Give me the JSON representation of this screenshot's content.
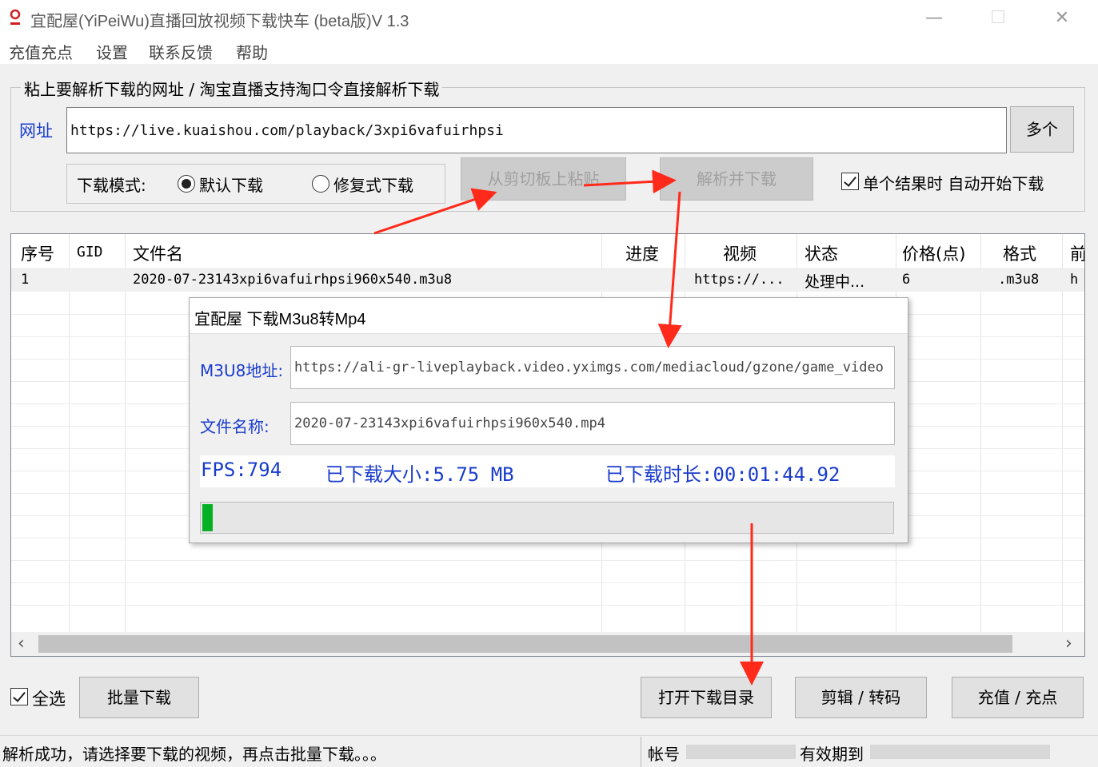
{
  "window": {
    "title": "宜配屋(YiPeiWu)直播回放视频下载快车 (beta版)V 1.3",
    "minimize": "—",
    "maximize": "☐",
    "close": "✕"
  },
  "menu": {
    "items": [
      "充值充点",
      "设置",
      "联系反馈",
      "帮助"
    ]
  },
  "url_group": {
    "caption": "粘上要解析下载的网址 / 淘宝直播支持淘口令直接解析下载",
    "url_label": "网址",
    "url_value": "https://live.kuaishou.com/playback/3xpi6vafuirhpsi",
    "multi_button": "多个",
    "mode_label": "下载模式:",
    "mode_options": [
      "默认下载",
      "修复式下载"
    ],
    "mode_selected": "默认下载",
    "paste_button": "从剪切板上粘贴",
    "parse_button": "解析并下载",
    "auto_start_label": "单个结果时 自动开始下载",
    "auto_start_checked": true
  },
  "table": {
    "columns": [
      "序号",
      "GID",
      "文件名",
      "进度",
      "视频",
      "状态",
      "价格(点)",
      "格式",
      "前"
    ],
    "rows": [
      {
        "index": "1",
        "gid": "",
        "filename": "2020-07-23143xpi6vafuirhpsi960x540.m3u8",
        "progress": "",
        "video": "https://...",
        "status": "处理中...",
        "price": "6",
        "format": ".m3u8",
        "prefix": "h"
      }
    ],
    "scroll_left": "‹",
    "scroll_right": "›"
  },
  "dialog": {
    "title": "宜配屋 下载M3u8转Mp4",
    "m3u8_label": "M3U8地址:",
    "m3u8_value": "https://ali-gr-liveplayback.video.yximgs.com/mediacloud/gzone/game_video",
    "filename_label": "文件名称:",
    "filename_value": "2020-07-23143xpi6vafuirhpsi960x540.mp4",
    "fps": "FPS:794",
    "downloaded_size": "已下载大小:5.75 MB",
    "downloaded_time": "已下载时长:00:01:44.92",
    "progress_fraction": 0.015
  },
  "bottom": {
    "select_all_label": "全选",
    "select_all_checked": true,
    "batch_button": "批量下载",
    "open_dir_button": "打开下载目录",
    "edit_button": "剪辑 / 转码",
    "recharge_button": "充值 / 充点"
  },
  "statusbar": {
    "message": "解析成功，请选择要下载的视频，再点击批量下载。。。",
    "account_label": "帐号",
    "expiry_label": "有效期到"
  },
  "colors": {
    "accent_blue": "#1a3ccc",
    "progress_green": "#06b025",
    "arrow_red": "#ff2a1a"
  }
}
